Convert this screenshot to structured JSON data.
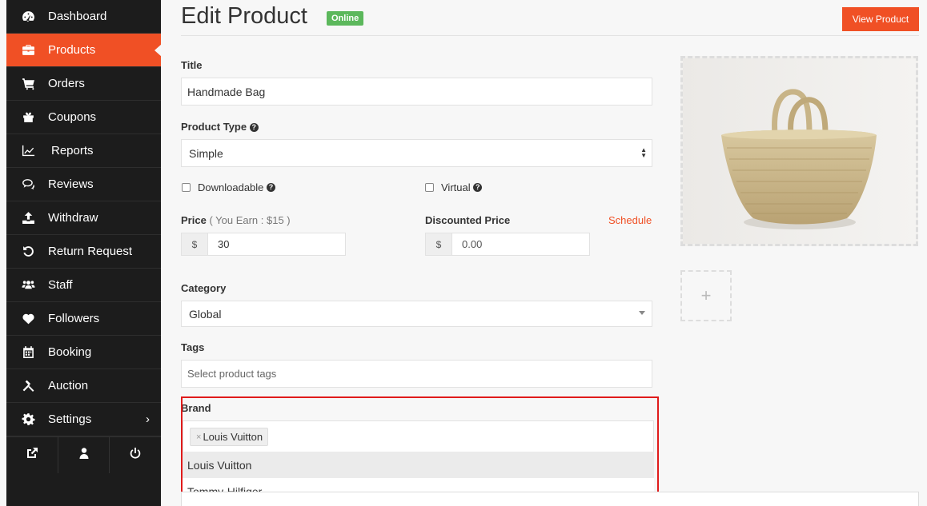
{
  "sidebar": {
    "items": [
      {
        "label": "Dashboard",
        "icon": "dashboard-icon"
      },
      {
        "label": "Products",
        "icon": "briefcase-icon",
        "active": true
      },
      {
        "label": "Orders",
        "icon": "cart-icon"
      },
      {
        "label": "Coupons",
        "icon": "gift-icon"
      },
      {
        "label": "Reports",
        "icon": "line-chart-icon"
      },
      {
        "label": "Reviews",
        "icon": "comments-icon"
      },
      {
        "label": "Withdraw",
        "icon": "upload-icon"
      },
      {
        "label": "Return Request",
        "icon": "undo-icon"
      },
      {
        "label": "Staff",
        "icon": "users-icon"
      },
      {
        "label": "Followers",
        "icon": "heart-icon"
      },
      {
        "label": "Booking",
        "icon": "calendar-icon"
      },
      {
        "label": "Auction",
        "icon": "gavel-icon"
      },
      {
        "label": "Settings",
        "icon": "gear-icon",
        "arrow": "›"
      }
    ],
    "footer": [
      "external-link-icon",
      "user-icon",
      "power-icon"
    ]
  },
  "header": {
    "title": "Edit Product",
    "status": "Online",
    "view_button": "View Product"
  },
  "form": {
    "title_label": "Title",
    "title_value": "Handmade Bag",
    "type_label": "Product Type",
    "type_value": "Simple",
    "downloadable_label": "Downloadable",
    "virtual_label": "Virtual",
    "price_label": "Price",
    "price_sub": "( You Earn : $15 )",
    "price_currency": "$",
    "price_value": "30",
    "discount_label": "Discounted Price",
    "schedule_label": "Schedule",
    "discount_currency": "$",
    "discount_placeholder": "0.00",
    "category_label": "Category",
    "category_value": "Global",
    "tags_label": "Tags",
    "tags_placeholder": "Select product tags",
    "brand_label": "Brand",
    "brand_selected": "Louis Vuitton",
    "brand_remove": "×",
    "brand_options": [
      "Louis Vuitton",
      "Tommy-Hilfiger"
    ]
  },
  "image": {
    "add_label": "+"
  },
  "colors": {
    "accent": "#f05025",
    "sidebar": "#1c1c1c",
    "badge": "#5cb85c",
    "highlight": "#e01b1b"
  }
}
